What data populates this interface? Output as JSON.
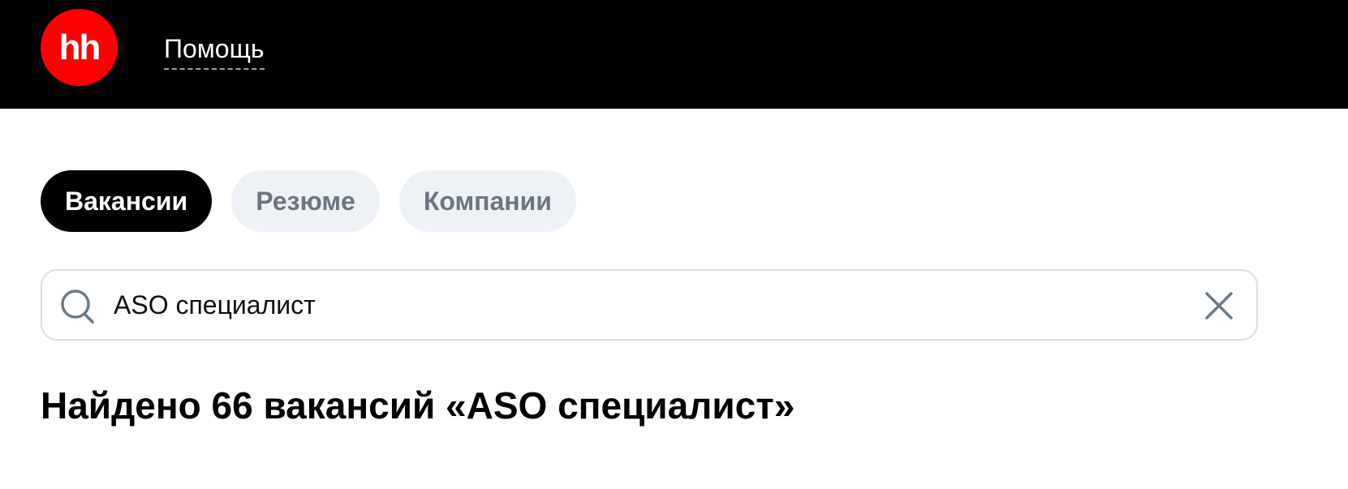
{
  "header": {
    "logo_text": "hh",
    "help_label": "Помощь",
    "colors": {
      "background": "#000000",
      "logo": "#ff0000"
    }
  },
  "tabs": [
    {
      "label": "Вакансии",
      "active": true
    },
    {
      "label": "Резюме",
      "active": false
    },
    {
      "label": "Компании",
      "active": false
    }
  ],
  "search": {
    "value": "ASO специалист",
    "icon": "search-icon",
    "clear_icon": "close-icon"
  },
  "results": {
    "title": "Найдено 66 вакансий «ASO специалист»"
  }
}
